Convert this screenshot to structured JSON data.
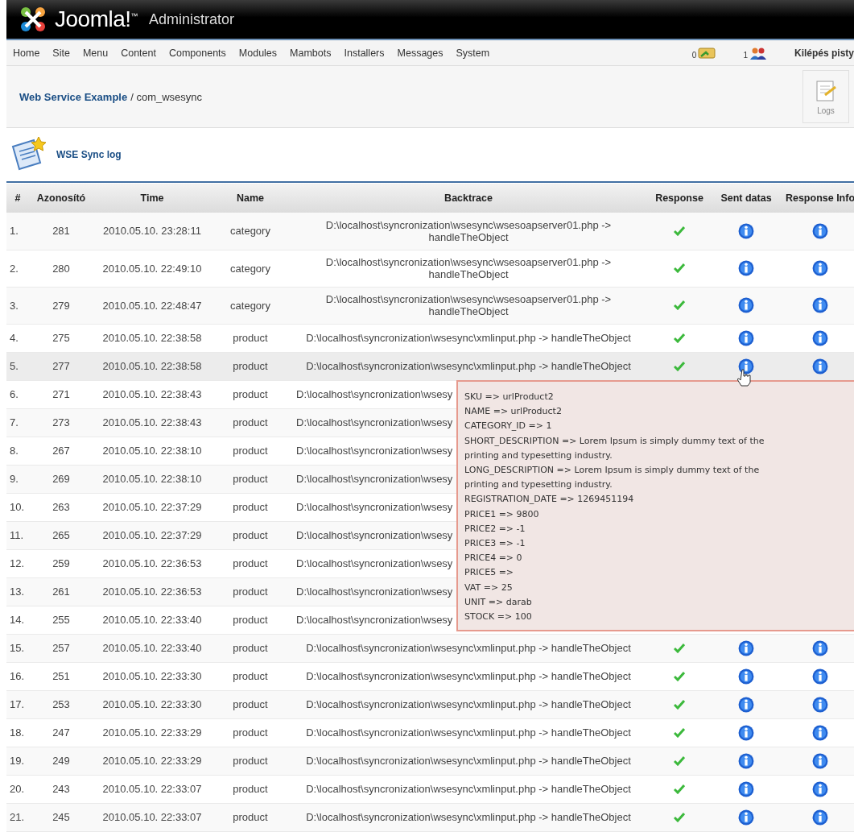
{
  "header": {
    "logo": "Joomla!$^{™}$",
    "title": "Administrator"
  },
  "menu": {
    "items": [
      "Home",
      "Site",
      "Menu",
      "Content",
      "Components",
      "Modules",
      "Mambots",
      "Installers",
      "Messages",
      "System"
    ],
    "messages_count": "0",
    "users_count": "1",
    "logout": "Kilépés pisty"
  },
  "toolbar": {
    "breadcrumb_link": "Web Service Example",
    "breadcrumb_rest": "/ com_wsesync",
    "buttons": [
      "Logs"
    ]
  },
  "page_title": "WSE Sync log",
  "table": {
    "columns": [
      "#",
      "Azonosító",
      "Time",
      "Name",
      "Backtrace",
      "Response",
      "Sent datas",
      "Response Info"
    ],
    "rows": [
      {
        "num": "1.",
        "id": "281",
        "time": "2010.05.10. 23:28:11",
        "name": "category",
        "backtrace": "D:\\localhost\\syncronization\\wsesync\\wsesoapserver01.php -> handleTheObject",
        "covered": false,
        "hovered": false,
        "response_ok": true
      },
      {
        "num": "2.",
        "id": "280",
        "time": "2010.05.10. 22:49:10",
        "name": "category",
        "backtrace": "D:\\localhost\\syncronization\\wsesync\\wsesoapserver01.php -> handleTheObject",
        "covered": false,
        "hovered": false,
        "response_ok": true
      },
      {
        "num": "3.",
        "id": "279",
        "time": "2010.05.10. 22:48:47",
        "name": "category",
        "backtrace": "D:\\localhost\\syncronization\\wsesync\\wsesoapserver01.php -> handleTheObject",
        "covered": false,
        "hovered": false,
        "response_ok": true
      },
      {
        "num": "4.",
        "id": "275",
        "time": "2010.05.10. 22:38:58",
        "name": "product",
        "backtrace": "D:\\localhost\\syncronization\\wsesync\\xmlinput.php -> handleTheObject",
        "covered": false,
        "hovered": false,
        "response_ok": true
      },
      {
        "num": "5.",
        "id": "277",
        "time": "2010.05.10. 22:38:58",
        "name": "product",
        "backtrace": "D:\\localhost\\syncronization\\wsesync\\xmlinput.php -> handleTheObject",
        "covered": false,
        "hovered": true,
        "response_ok": true
      },
      {
        "num": "6.",
        "id": "271",
        "time": "2010.05.10. 22:38:43",
        "name": "product",
        "backtrace": "D:\\localhost\\syncronization\\wsesy",
        "covered": true,
        "hovered": false
      },
      {
        "num": "7.",
        "id": "273",
        "time": "2010.05.10. 22:38:43",
        "name": "product",
        "backtrace": "D:\\localhost\\syncronization\\wsesy",
        "covered": true,
        "hovered": false
      },
      {
        "num": "8.",
        "id": "267",
        "time": "2010.05.10. 22:38:10",
        "name": "product",
        "backtrace": "D:\\localhost\\syncronization\\wsesy",
        "covered": true,
        "hovered": false
      },
      {
        "num": "9.",
        "id": "269",
        "time": "2010.05.10. 22:38:10",
        "name": "product",
        "backtrace": "D:\\localhost\\syncronization\\wsesy",
        "covered": true,
        "hovered": false
      },
      {
        "num": "10.",
        "id": "263",
        "time": "2010.05.10. 22:37:29",
        "name": "product",
        "backtrace": "D:\\localhost\\syncronization\\wsesy",
        "covered": true,
        "hovered": false
      },
      {
        "num": "11.",
        "id": "265",
        "time": "2010.05.10. 22:37:29",
        "name": "product",
        "backtrace": "D:\\localhost\\syncronization\\wsesy",
        "covered": true,
        "hovered": false
      },
      {
        "num": "12.",
        "id": "259",
        "time": "2010.05.10. 22:36:53",
        "name": "product",
        "backtrace": "D:\\localhost\\syncronization\\wsesy",
        "covered": true,
        "hovered": false
      },
      {
        "num": "13.",
        "id": "261",
        "time": "2010.05.10. 22:36:53",
        "name": "product",
        "backtrace": "D:\\localhost\\syncronization\\wsesy",
        "covered": true,
        "hovered": false
      },
      {
        "num": "14.",
        "id": "255",
        "time": "2010.05.10. 22:33:40",
        "name": "product",
        "backtrace": "D:\\localhost\\syncronization\\wsesy",
        "covered": true,
        "hovered": false
      },
      {
        "num": "15.",
        "id": "257",
        "time": "2010.05.10. 22:33:40",
        "name": "product",
        "backtrace": "D:\\localhost\\syncronization\\wsesync\\xmlinput.php -> handleTheObject",
        "covered": false,
        "hovered": false,
        "response_ok": true
      },
      {
        "num": "16.",
        "id": "251",
        "time": "2010.05.10. 22:33:30",
        "name": "product",
        "backtrace": "D:\\localhost\\syncronization\\wsesync\\xmlinput.php -> handleTheObject",
        "covered": false,
        "hovered": false,
        "response_ok": true
      },
      {
        "num": "17.",
        "id": "253",
        "time": "2010.05.10. 22:33:30",
        "name": "product",
        "backtrace": "D:\\localhost\\syncronization\\wsesync\\xmlinput.php -> handleTheObject",
        "covered": false,
        "hovered": false,
        "response_ok": true
      },
      {
        "num": "18.",
        "id": "247",
        "time": "2010.05.10. 22:33:29",
        "name": "product",
        "backtrace": "D:\\localhost\\syncronization\\wsesync\\xmlinput.php -> handleTheObject",
        "covered": false,
        "hovered": false,
        "response_ok": true
      },
      {
        "num": "19.",
        "id": "249",
        "time": "2010.05.10. 22:33:29",
        "name": "product",
        "backtrace": "D:\\localhost\\syncronization\\wsesync\\xmlinput.php -> handleTheObject",
        "covered": false,
        "hovered": false,
        "response_ok": true
      },
      {
        "num": "20.",
        "id": "243",
        "time": "2010.05.10. 22:33:07",
        "name": "product",
        "backtrace": "D:\\localhost\\syncronization\\wsesync\\xmlinput.php -> handleTheObject",
        "covered": false,
        "hovered": false,
        "response_ok": true
      },
      {
        "num": "21.",
        "id": "245",
        "time": "2010.05.10. 22:33:07",
        "name": "product",
        "backtrace": "D:\\localhost\\syncronization\\wsesync\\xmlinput.php -> handleTheObject",
        "covered": false,
        "hovered": false,
        "response_ok": true
      }
    ]
  },
  "tooltip": {
    "lines": [
      "SKU => urlProduct2",
      "NAME => urlProduct2",
      "CATEGORY_ID => 1",
      "SHORT_DESCRIPTION => Lorem Ipsum is simply dummy text of the",
      "printing and typesetting industry.",
      "LONG_DESCRIPTION => Lorem Ipsum is simply dummy text of the",
      "printing and typesetting industry.",
      "REGISTRATION_DATE => 1269451194",
      "PRICE1 => 9800",
      "PRICE2 => -1",
      "PRICE3 => -1",
      "PRICE4 => 0",
      "PRICE5 =>",
      "VAT => 25",
      "UNIT => darab",
      "STOCK => 100"
    ]
  }
}
